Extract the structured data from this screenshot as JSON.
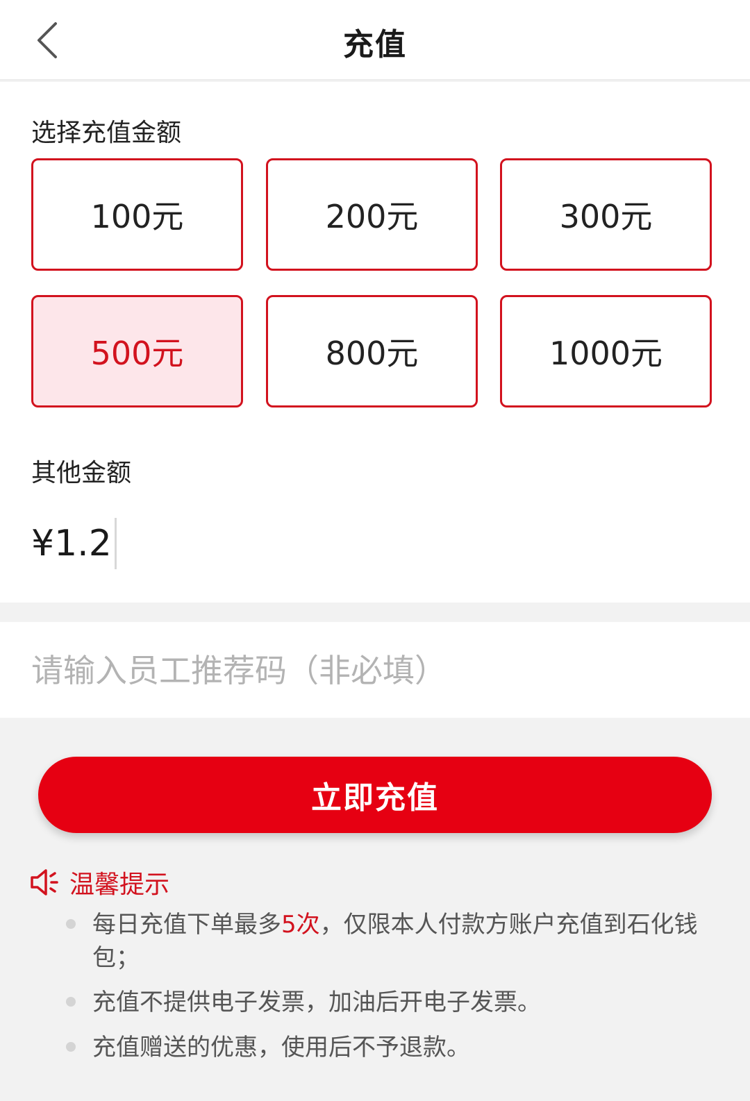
{
  "header": {
    "title": "充值"
  },
  "amounts": {
    "label": "选择充值金额",
    "options": [
      "100元",
      "200元",
      "300元",
      "500元",
      "800元",
      "1000元"
    ],
    "selected": "500元"
  },
  "other": {
    "label": "其他金额",
    "currency": "¥",
    "value": "1.2"
  },
  "referral": {
    "placeholder": "请输入员工推荐码（非必填）",
    "value": ""
  },
  "submit": {
    "label": "立即充值"
  },
  "tips": {
    "title": "温馨提示",
    "items": [
      {
        "before": "每日充值下单最多",
        "highlight": "5次",
        "after": "，仅限本人付款方账户充值到石化钱包；"
      },
      {
        "text": "充值不提供电子发票，加油后开电子发票。"
      },
      {
        "text": "充值赠送的优惠，使用后不予退款。"
      }
    ]
  },
  "colors": {
    "accent": "#e60012",
    "selected_bg": "#fde6ea",
    "border": "#d2121e"
  },
  "icons": {
    "back": "chevron-left-icon",
    "tips": "speaker-icon"
  }
}
